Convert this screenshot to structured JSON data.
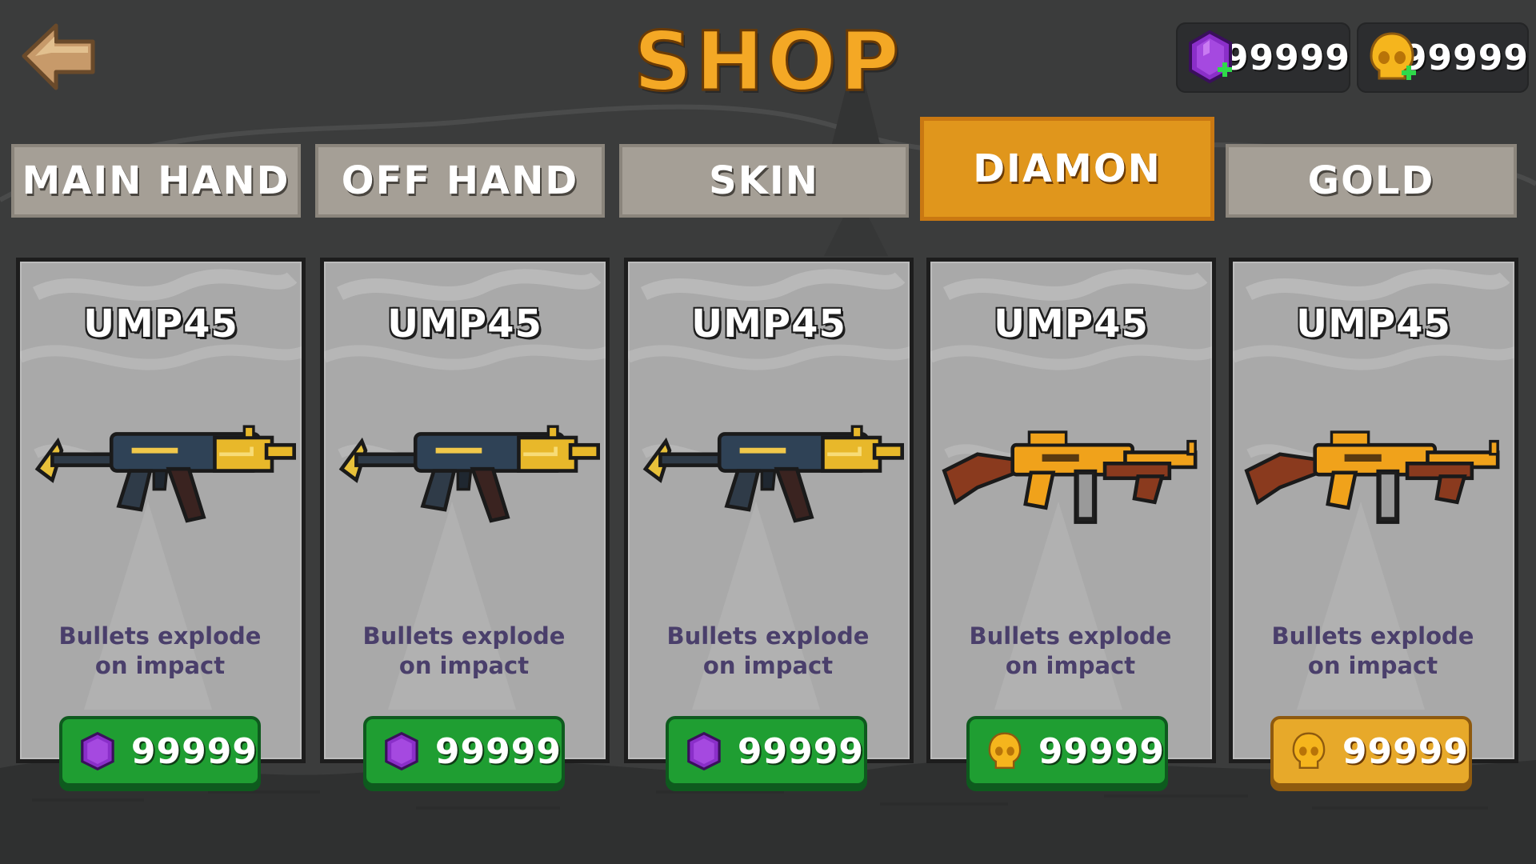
{
  "header": {
    "title": "SHOP",
    "back_icon": "back-arrow-icon",
    "diamond_balance": "99999",
    "gold_balance": "99999"
  },
  "tabs": [
    {
      "label": "MAIN HAND",
      "active": false
    },
    {
      "label": "OFF HAND",
      "active": false
    },
    {
      "label": "SKIN",
      "active": false
    },
    {
      "label": "DIAMON",
      "active": true
    },
    {
      "label": "GOLD",
      "active": false
    }
  ],
  "items": [
    {
      "name": "UMP45",
      "description_line1": "Bullets explode",
      "description_line2": "on impact",
      "price": "99999",
      "currency": "diamond",
      "gun_style": "smg-blue-gold",
      "button_color": "green"
    },
    {
      "name": "UMP45",
      "description_line1": "Bullets explode",
      "description_line2": "on impact",
      "price": "99999",
      "currency": "diamond",
      "gun_style": "smg-blue-gold",
      "button_color": "green"
    },
    {
      "name": "UMP45",
      "description_line1": "Bullets explode",
      "description_line2": "on impact",
      "price": "99999",
      "currency": "diamond",
      "gun_style": "smg-blue-gold",
      "button_color": "green"
    },
    {
      "name": "UMP45",
      "description_line1": "Bullets explode",
      "description_line2": "on impact",
      "price": "99999",
      "currency": "gold",
      "gun_style": "tommy-gun-orange",
      "button_color": "green"
    },
    {
      "name": "UMP45",
      "description_line1": "Bullets explode",
      "description_line2": "on impact",
      "price": "99999",
      "currency": "gold",
      "gun_style": "tommy-gun-orange",
      "button_color": "gold"
    }
  ],
  "colors": {
    "accent": "#e0961c",
    "title": "#f4a825",
    "buy_green": "#1f9e32",
    "buy_gold": "#e7a92a",
    "diamond": "#8a2fc9",
    "gold_skull": "#f5b51d"
  }
}
